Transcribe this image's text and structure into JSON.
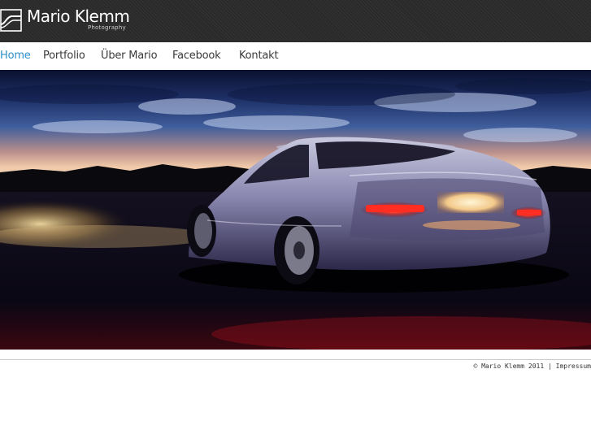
{
  "brand": {
    "name": "Mario Klemm",
    "tagline": "Photography"
  },
  "nav": {
    "items": [
      {
        "label": "Home",
        "active": true
      },
      {
        "label": "Portfolio",
        "active": false
      },
      {
        "label": "Über Mario",
        "active": false
      },
      {
        "label": "Facebook",
        "active": false
      },
      {
        "label": "Kontakt",
        "active": false
      }
    ]
  },
  "footer": {
    "copyright": "© Mario Klemm 2011",
    "separator": "|",
    "impressum": "Impressum"
  },
  "colors": {
    "header_bg": "#2a2a2a",
    "nav_active": "#2c8fc9",
    "nav_text": "#3a3a3a"
  }
}
